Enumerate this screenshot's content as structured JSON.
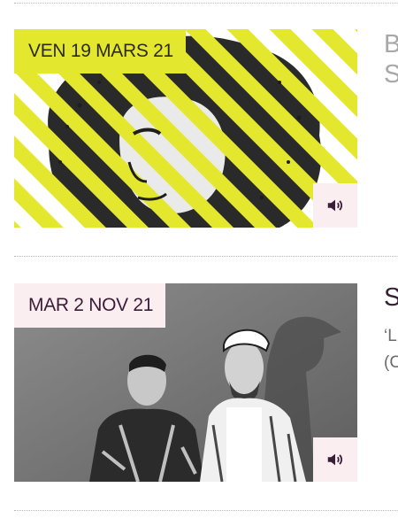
{
  "events": [
    {
      "date": "VEN 19 MARS 21",
      "side_title_line1": "B",
      "side_title_line2": "S",
      "sound_icon": "speaker-volume-icon",
      "colors": {
        "badge": "#e3e82f",
        "stripe": "#e3e82f"
      }
    },
    {
      "date": "MAR 2 NOV 21",
      "side_title_line1": "S",
      "side_text_line1": "‘L",
      "side_text_line2": "(C",
      "sound_icon": "speaker-volume-icon",
      "colors": {
        "badge": "#fbeef0"
      }
    }
  ],
  "colors": {
    "accent_dark": "#3a1e37",
    "divider": "#b9b9b9"
  }
}
